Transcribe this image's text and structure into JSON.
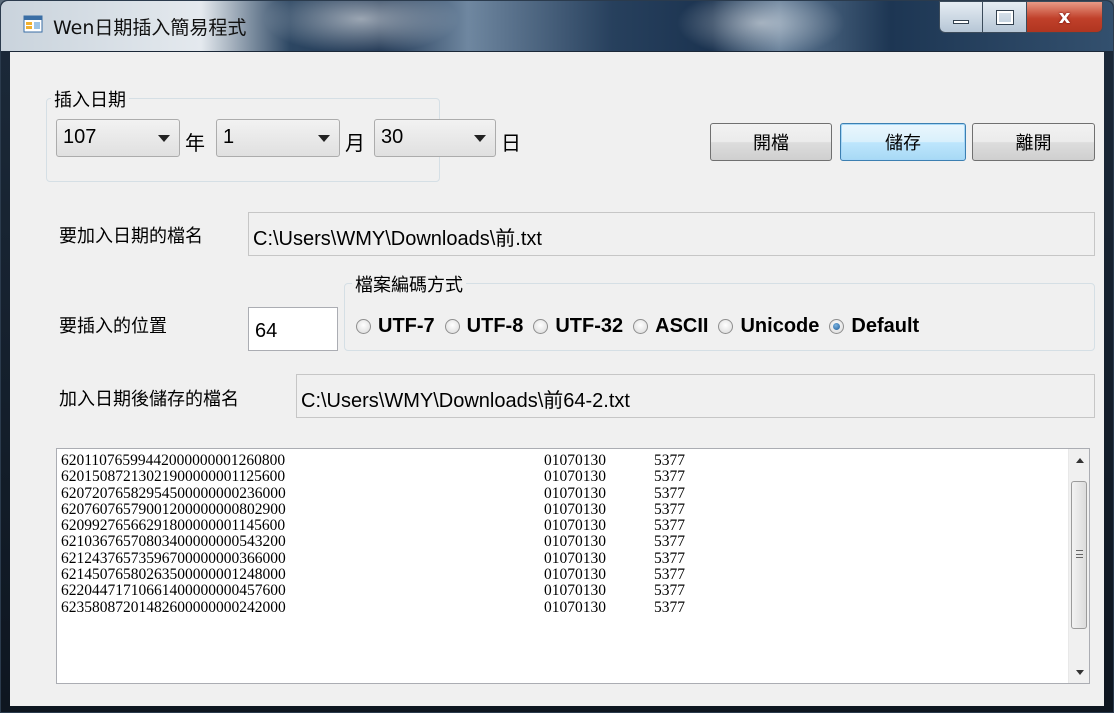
{
  "window": {
    "title": "Wen日期插入簡易程式",
    "app_icon": "windows-form-icon",
    "caption": {
      "minimize_icon": "minimize-icon",
      "maximize_icon": "maximize-icon",
      "close_icon": "close-icon",
      "close_glyph": "x"
    }
  },
  "date_group": {
    "label": "插入日期",
    "year": {
      "value": "107",
      "unit": "年"
    },
    "month": {
      "value": "1",
      "unit": "月"
    },
    "day": {
      "value": "30",
      "unit": "日"
    }
  },
  "buttons": {
    "open": "開檔",
    "save": "儲存",
    "exit": "離開"
  },
  "source_file": {
    "label": "要加入日期的檔名",
    "value": "C:\\Users\\WMY\\Downloads\\前.txt"
  },
  "position": {
    "label": "要插入的位置",
    "value": "64"
  },
  "encoding_group": {
    "label": "檔案編碼方式",
    "options": [
      "UTF-7",
      "UTF-8",
      "UTF-32",
      "ASCII",
      "Unicode",
      "Default"
    ],
    "selected": "Default"
  },
  "output_file": {
    "label": "加入日期後儲存的檔名",
    "value": "C:\\Users\\WMY\\Downloads\\前64-2.txt"
  },
  "content_lines": [
    [
      "62011076599442000000001260800",
      "01070130",
      "5377"
    ],
    [
      "62015087213021900000001125600",
      "01070130",
      "5377"
    ],
    [
      "62072076582954500000000236000",
      "01070130",
      "5377"
    ],
    [
      "62076076579001200000000802900",
      "01070130",
      "5377"
    ],
    [
      "62099276566291800000001145600",
      "01070130",
      "5377"
    ],
    [
      "62103676570803400000000543200",
      "01070130",
      "5377"
    ],
    [
      "62124376573596700000000366000",
      "01070130",
      "5377"
    ],
    [
      "62145076580263500000001248000",
      "01070130",
      "5377"
    ],
    [
      "62204471710661400000000457600",
      "01070130",
      "5377"
    ],
    [
      "62358087201482600000000242000",
      "01070130",
      "5377"
    ]
  ]
}
